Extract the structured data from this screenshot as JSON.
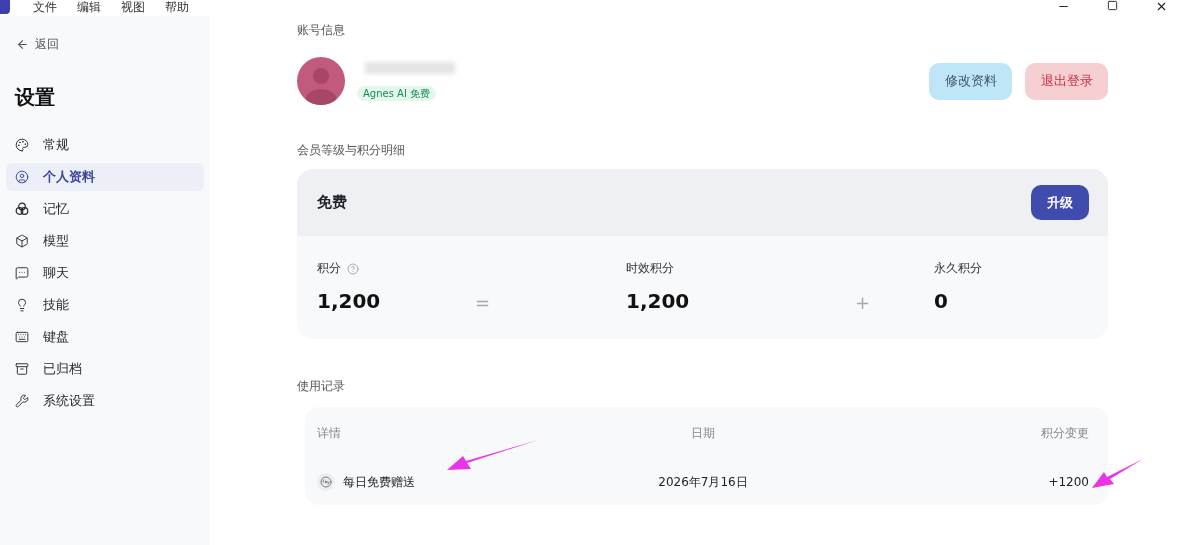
{
  "app_menu": [
    "文件",
    "编辑",
    "视图",
    "帮助"
  ],
  "sidebar": {
    "back": "返回",
    "title": "设置",
    "items": [
      {
        "label": "常规",
        "selected": false
      },
      {
        "label": "个人资料",
        "selected": true
      },
      {
        "label": "记忆",
        "selected": false
      },
      {
        "label": "模型",
        "selected": false
      },
      {
        "label": "聊天",
        "selected": false
      },
      {
        "label": "技能",
        "selected": false
      },
      {
        "label": "键盘",
        "selected": false
      },
      {
        "label": "已归档",
        "selected": false
      },
      {
        "label": "系统设置",
        "selected": false
      }
    ]
  },
  "account": {
    "heading": "账号信息",
    "plan_badge": "Agnes AI 免费",
    "buttons": [
      {
        "label": "修改资料",
        "kind": "edit"
      },
      {
        "label": "退出登录",
        "kind": "logout"
      }
    ]
  },
  "membership": {
    "heading": "会员等级与积分明细",
    "tier": "免费",
    "upgrade": "升级",
    "operators": [
      "=",
      "+"
    ],
    "points": [
      {
        "label": "积分",
        "help": true,
        "value": "1,200"
      },
      {
        "label": "时效积分",
        "help": false,
        "value": "1,200"
      },
      {
        "label": "永久积分",
        "help": false,
        "value": "0"
      }
    ]
  },
  "usage": {
    "heading": "使用记录",
    "columns": [
      "详情",
      "日期",
      "积分变更"
    ],
    "rows": [
      {
        "detail": "每日免费赠送",
        "date": "2026年7月16日",
        "change": "+1200"
      }
    ]
  }
}
